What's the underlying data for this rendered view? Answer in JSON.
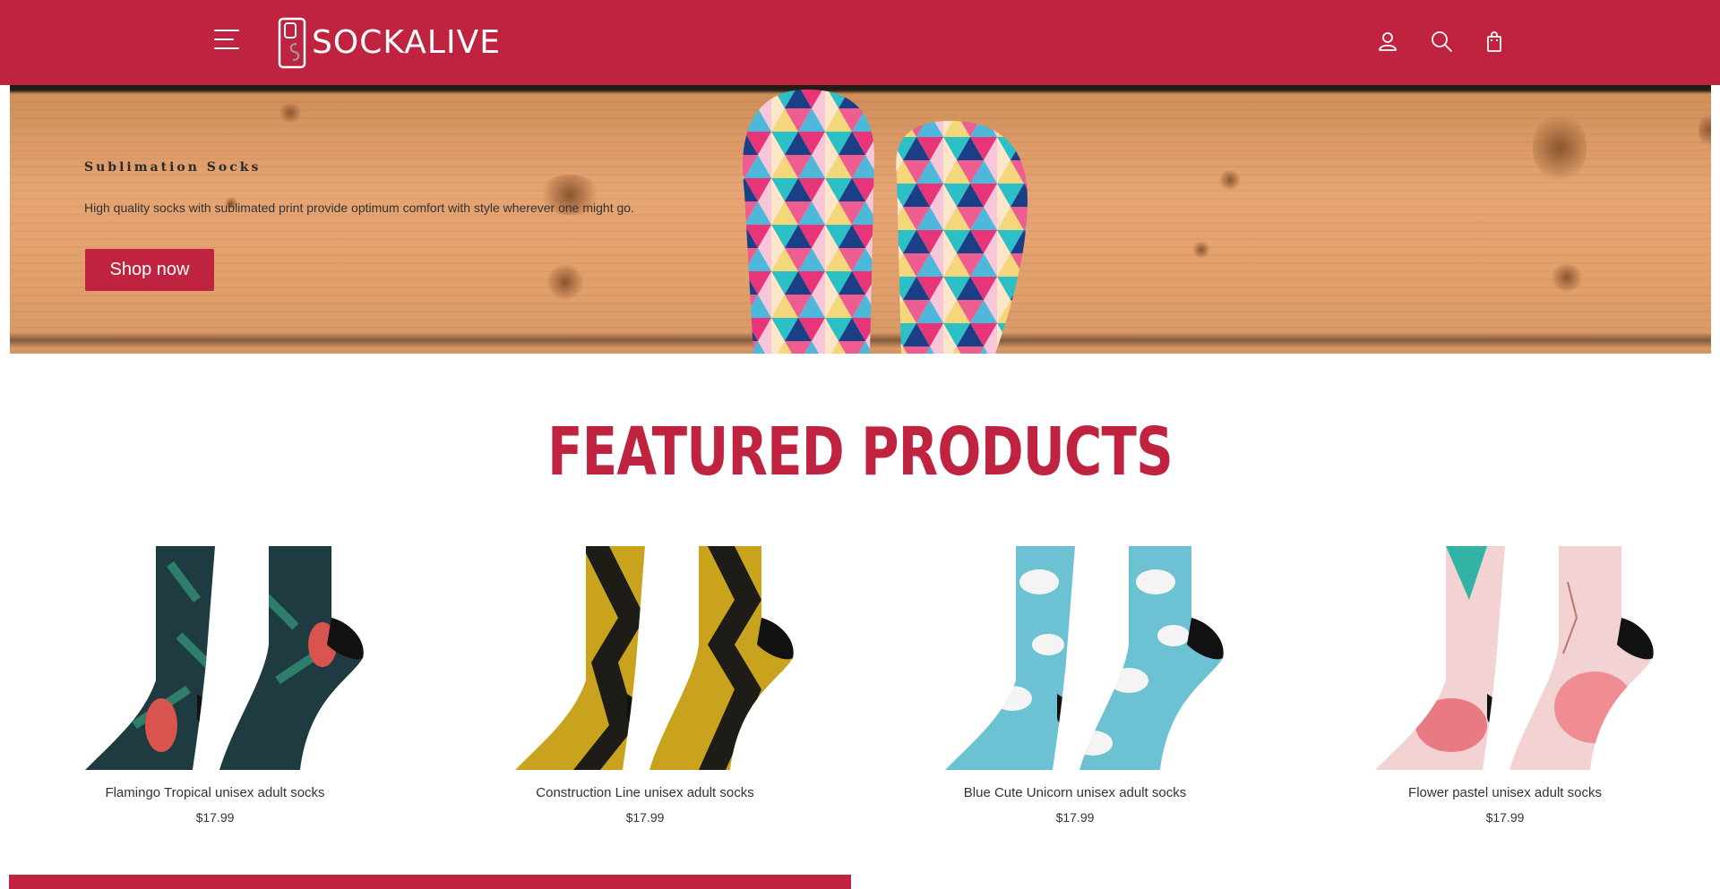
{
  "header": {
    "brand": "SOCKALIVE",
    "icons": [
      "menu-icon",
      "user-icon",
      "search-icon",
      "shopping-bag-icon"
    ]
  },
  "hero": {
    "subtitle": "Sublimation Socks",
    "description": "High quality socks with sublimated print provide optimum comfort with style wherever one might go.",
    "cta_label": "Shop now"
  },
  "featured": {
    "title": "FEATURED PRODUCTS",
    "products": [
      {
        "name": "Flamingo Tropical unisex adult socks",
        "price": "$17.99"
      },
      {
        "name": "Construction Line unisex adult socks",
        "price": "$17.99"
      },
      {
        "name": "Blue Cute Unicorn unisex adult socks",
        "price": "$17.99"
      },
      {
        "name": "Flower pastel unisex adult socks",
        "price": "$17.99"
      }
    ]
  },
  "colors": {
    "brand": "#c0233f",
    "text": "#333333",
    "background": "#ffffff"
  }
}
